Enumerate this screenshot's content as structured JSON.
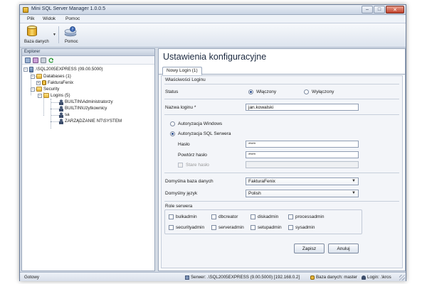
{
  "window": {
    "title": "Mini SQL Server Manager 1.0.0.5",
    "controls": {
      "minimize": "–",
      "maximize": "□",
      "close": "✕"
    }
  },
  "menu": {
    "items": [
      "Plik",
      "Widok",
      "Pomoc"
    ]
  },
  "toolbar": {
    "database_label": "Baza danych",
    "help_label": "Pomoc",
    "dropdown_arrow": "▼"
  },
  "explorer": {
    "title": "Explorer",
    "tree": {
      "server": ".\\SQL2005EXPRESS (09.00.5000)",
      "databases": "Databases (1)",
      "database_item": "FakturaFenix",
      "security": "Security",
      "logins": "Logins (5)",
      "login_items": [
        "BUILTIN\\Administratorzy",
        "BUILTIN\\Użytkownicy",
        "sa",
        "ZARZĄDZANIE NT\\SYSTEM"
      ]
    },
    "expander_minus": "−",
    "expander_plus": "+"
  },
  "main": {
    "title": "Ustawienia konfiguracyjne",
    "tab": "Nowy Login (1)",
    "form": {
      "section_title": "Właściwości Loginu",
      "status_label": "Status",
      "status_enabled": "Włączony",
      "status_disabled": "Wyłączony",
      "login_name_label": "Nazwa loginu *",
      "login_name_value": "jan.kowalski",
      "auth_windows": "Autoryzacja Windows",
      "auth_sql": "Autoryzacja SQL Serwera",
      "password_label": "Hasło",
      "password_value": "****",
      "repeat_password_label": "Powtórz hasło",
      "repeat_password_value": "****",
      "old_password_label": "Stare hasło",
      "default_db_label": "Domyślna baza danych",
      "default_db_value": "FakturaFenix",
      "default_lang_label": "Domyślny język",
      "default_lang_value": "Polish",
      "combo_arrow": "▼",
      "roles_title": "Role serwera",
      "roles": [
        "bulkadmin",
        "dbcreator",
        "diskadmin",
        "processadmin",
        "securityadmin",
        "serveradmin",
        "setupadmin",
        "sysadmin"
      ],
      "save_button": "Zapisz",
      "cancel_button": "Anuluj"
    }
  },
  "statusbar": {
    "ready": "Gotowy",
    "server": "Serwer: .\\SQL2005EXPRESS (9.00.5000) [192.168.0.2]",
    "database": "Baza danych: master",
    "login": "Login: .\\kros"
  }
}
